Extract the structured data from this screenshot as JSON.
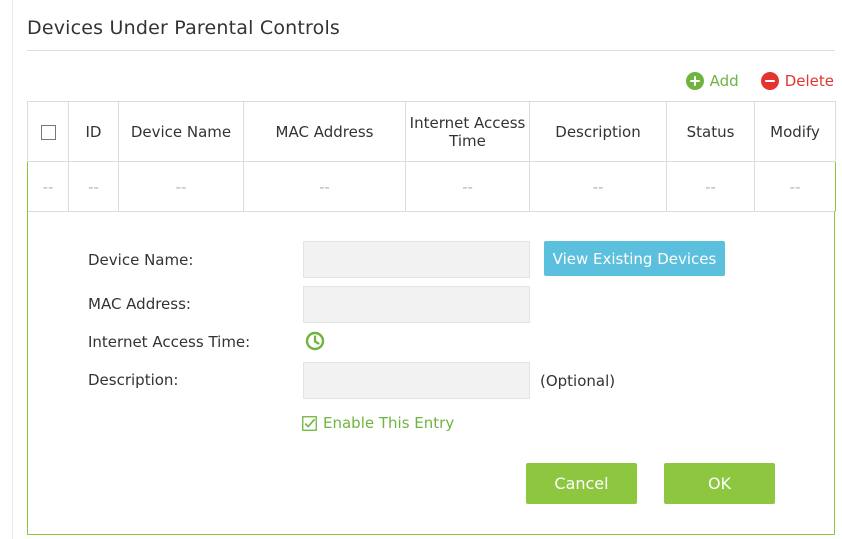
{
  "section": {
    "title": "Devices Under Parental Controls"
  },
  "actions": {
    "add_label": "Add",
    "delete_label": "Delete"
  },
  "table": {
    "headers": {
      "id": "ID",
      "device_name": "Device Name",
      "mac_address": "MAC Address",
      "internet_access_time": "Internet Access Time",
      "description": "Description",
      "status": "Status",
      "modify": "Modify"
    },
    "rows": [
      {
        "select": "--",
        "id": "--",
        "device_name": "--",
        "mac_address": "--",
        "internet_access_time": "--",
        "description": "--",
        "status": "--",
        "modify": "--"
      }
    ]
  },
  "form": {
    "device_name_label": "Device Name:",
    "device_name_value": "",
    "view_devices_button": "View Existing Devices",
    "mac_address_label": "MAC Address:",
    "mac_address_value": "",
    "internet_access_time_label": "Internet Access Time:",
    "description_label": "Description:",
    "description_value": "",
    "description_hint": "(Optional)",
    "enable_label": "Enable This Entry",
    "enable_checked": true,
    "cancel_button": "Cancel",
    "ok_button": "OK"
  },
  "colors": {
    "accent_green": "#8dc63f",
    "add_green": "#6fb43f",
    "delete_red": "#e3342f",
    "info_blue": "#5bc0de"
  },
  "icons": {
    "add": "plus-circle-icon",
    "delete": "minus-circle-icon",
    "time": "clock-icon",
    "enable": "checkbox-checked-icon"
  }
}
